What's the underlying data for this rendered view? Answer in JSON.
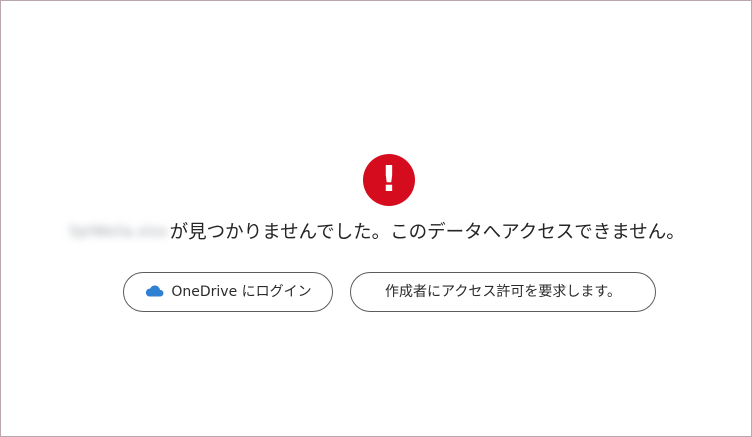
{
  "error": {
    "icon_glyph": "!",
    "icon_name": "error-exclamation-icon",
    "icon_color": "#d50b1e",
    "filename": "SplWeila.xlsx",
    "message": "が見つかりませんでした。このデータへアクセスできません。"
  },
  "actions": {
    "login_label": "OneDrive にログイン",
    "login_icon": "onedrive-cloud-icon",
    "cloud_color": "#2f7fd3",
    "request_label": "作成者にアクセス許可を要求します。"
  }
}
